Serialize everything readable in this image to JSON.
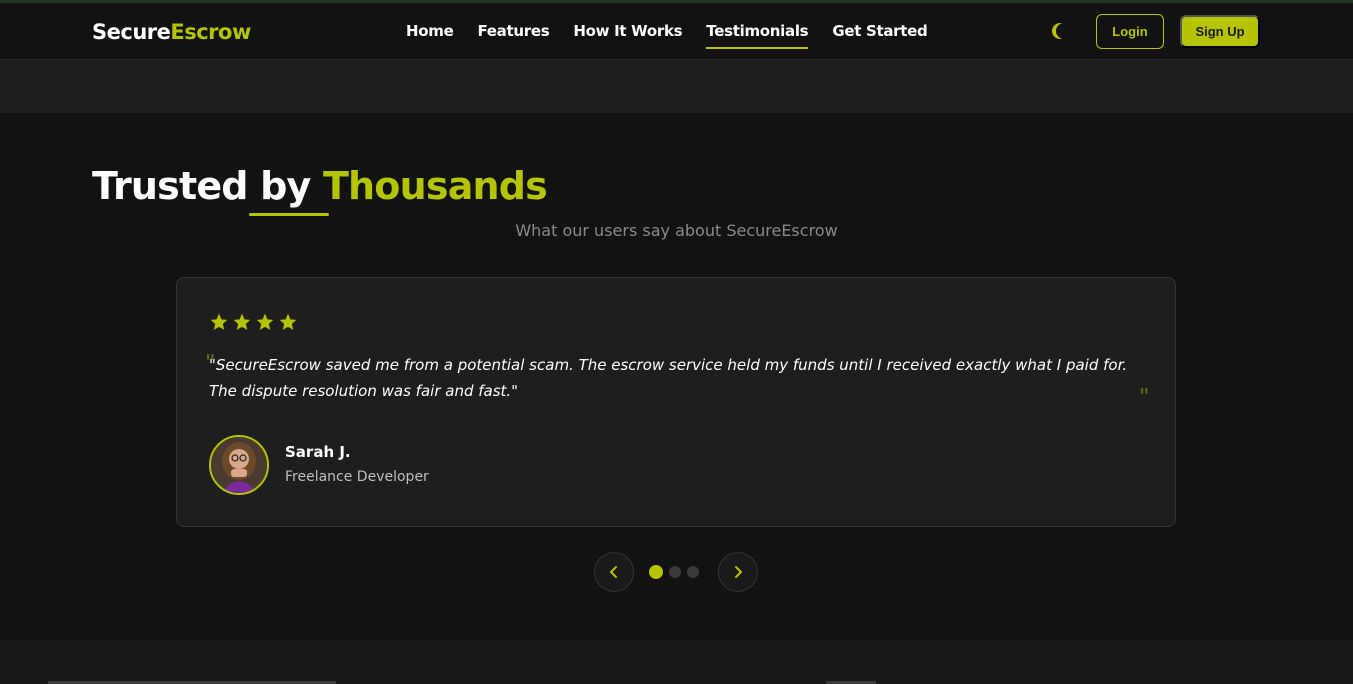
{
  "header": {
    "logo_part1": "Secure",
    "logo_part2": "Escrow",
    "nav": [
      {
        "label": "Home",
        "active": false
      },
      {
        "label": "Features",
        "active": false
      },
      {
        "label": "How It Works",
        "active": false
      },
      {
        "label": "Testimonials",
        "active": true
      },
      {
        "label": "Get Started",
        "active": false
      }
    ],
    "theme_icon": "moon-icon",
    "login_label": "Login",
    "signup_label": "Sign Up"
  },
  "section": {
    "title_part1": "Trusted by ",
    "title_part2": "Thousands",
    "subtitle": "What our users say about SecureEscrow"
  },
  "testimonial": {
    "rating": 4,
    "quote_open": "\"",
    "quote": "\"SecureEscrow saved me from a potential scam. The escrow service held my funds until I received exactly what I paid for. The dispute resolution was fair and fast.\"",
    "quote_close": "\"",
    "author_name": "Sarah J.",
    "author_role": "Freelance Developer"
  },
  "carousel": {
    "prev_icon": "chevron-left-icon",
    "next_icon": "chevron-right-icon",
    "slides": 3,
    "active_index": 0
  },
  "colors": {
    "accent": "#b5c400",
    "background": "#121212",
    "card": "#1e1e1e"
  }
}
